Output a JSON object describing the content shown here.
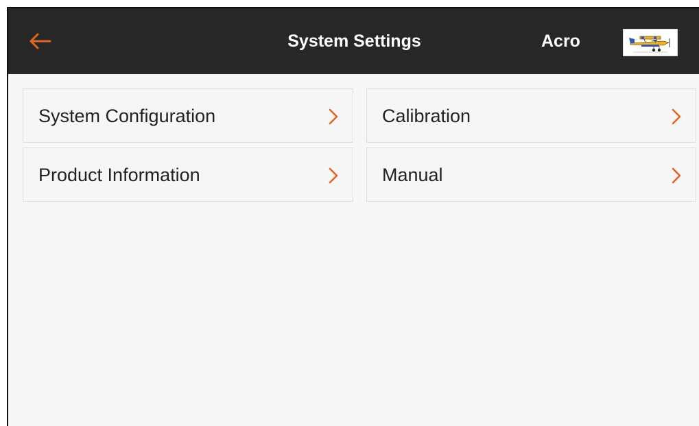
{
  "header": {
    "title": "System Settings",
    "model_name": "Acro",
    "back_icon": "arrow-left-icon",
    "model_thumbnail": "airplane-icon"
  },
  "menu": {
    "items": [
      {
        "label": "System Configuration",
        "icon": "chevron-right-icon"
      },
      {
        "label": "Calibration",
        "icon": "chevron-right-icon"
      },
      {
        "label": "Product Information",
        "icon": "chevron-right-icon"
      },
      {
        "label": "Manual",
        "icon": "chevron-right-icon"
      }
    ]
  },
  "colors": {
    "header_bg": "#272727",
    "accent": "#e3661f",
    "content_bg": "#f7f7f7",
    "item_border": "#dcdcdc"
  }
}
